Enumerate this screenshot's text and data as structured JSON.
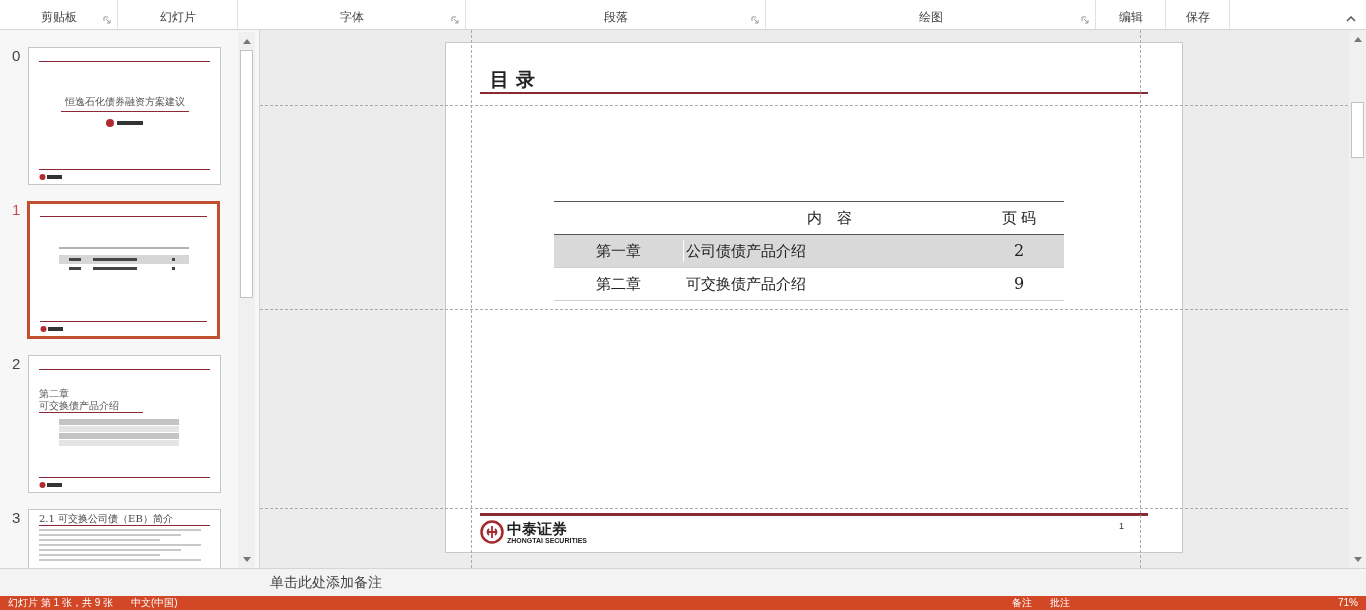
{
  "ribbon_groups": [
    {
      "label": "剪贴板",
      "has_launcher": true
    },
    {
      "label": "幻灯片",
      "has_launcher": false
    },
    {
      "label": "字体",
      "has_launcher": true
    },
    {
      "label": "段落",
      "has_launcher": true
    },
    {
      "label": "绘图",
      "has_launcher": true
    },
    {
      "label": "编辑",
      "has_launcher": false
    },
    {
      "label": "保存",
      "has_launcher": false
    }
  ],
  "thumbnails": [
    {
      "number": "0",
      "selected": false,
      "kind": "cover",
      "title": "恒逸石化债券融资方案建议"
    },
    {
      "number": "1",
      "selected": true,
      "kind": "contents"
    },
    {
      "number": "2",
      "selected": false,
      "kind": "chapter",
      "subtitle": "第二章",
      "title": "可交换债产品介绍"
    },
    {
      "number": "3",
      "selected": false,
      "kind": "content",
      "title": "2.1 可交换公司债（EB）简介"
    }
  ],
  "slide": {
    "title": "目 录",
    "table": {
      "columns": [
        "",
        "内　容",
        "页 码"
      ],
      "rows": [
        {
          "chapter": "第一章",
          "name": "公司债债产品介绍",
          "page": "2",
          "shaded": true
        },
        {
          "chapter": "第二章",
          "name": "可交换债产品介绍",
          "page": "9",
          "shaded": false
        }
      ]
    },
    "logo": {
      "name": "中泰证券",
      "english": "ZHONGTAI SECURITIES"
    },
    "page_number": "1"
  },
  "notes": {
    "placeholder": "单击此处添加备注"
  },
  "status_bar": {
    "slide_info": "幻灯片 第 1 张，共 9 张",
    "language": "中文(中国)",
    "notes": "备注",
    "comments": "批注",
    "zoom": "71%"
  }
}
